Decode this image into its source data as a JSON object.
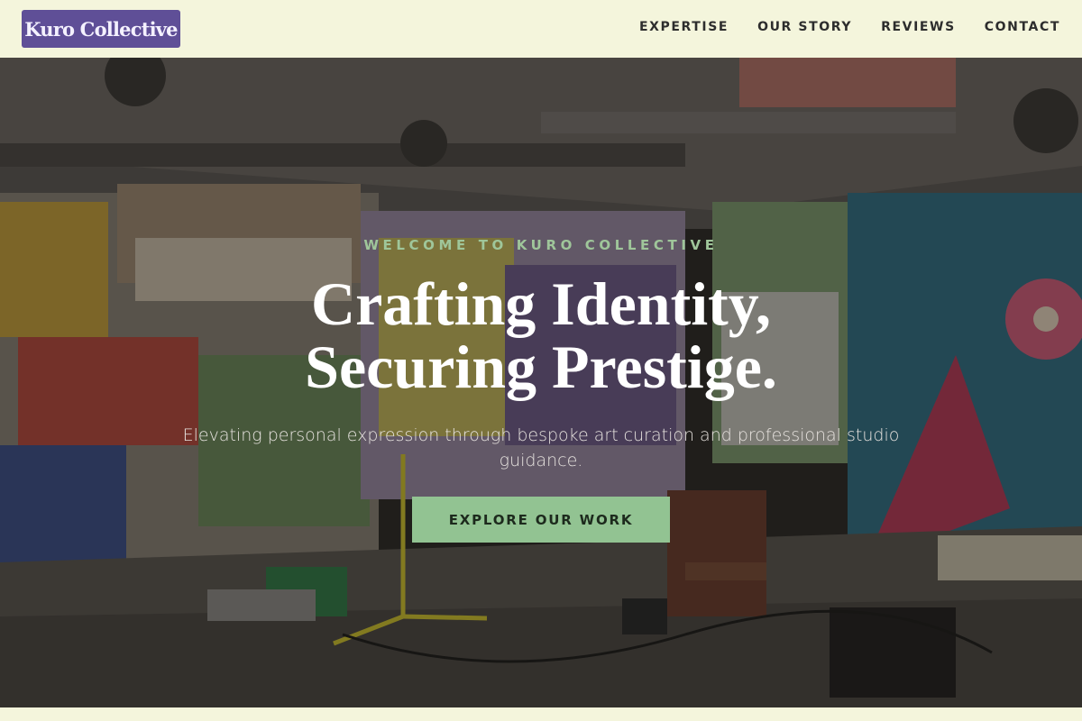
{
  "brand": {
    "logo": "Kuro Collective"
  },
  "nav": {
    "items": [
      {
        "label": "EXPERTISE"
      },
      {
        "label": "OUR STORY"
      },
      {
        "label": "REVIEWS"
      },
      {
        "label": "CONTACT"
      }
    ]
  },
  "hero": {
    "eyebrow": "WELCOME TO KURO COLLECTIVE",
    "title_line1": "Crafting Identity,",
    "title_line2": "Securing Prestige.",
    "subtitle": "Elevating personal expression through bespoke art curation and professional studio guidance.",
    "cta_label": "EXPLORE OUR WORK"
  },
  "colors": {
    "background": "#f4f5dc",
    "logo_bg": "#5f4f97",
    "accent_green": "#92c392",
    "eyebrow": "#9fc69a"
  }
}
